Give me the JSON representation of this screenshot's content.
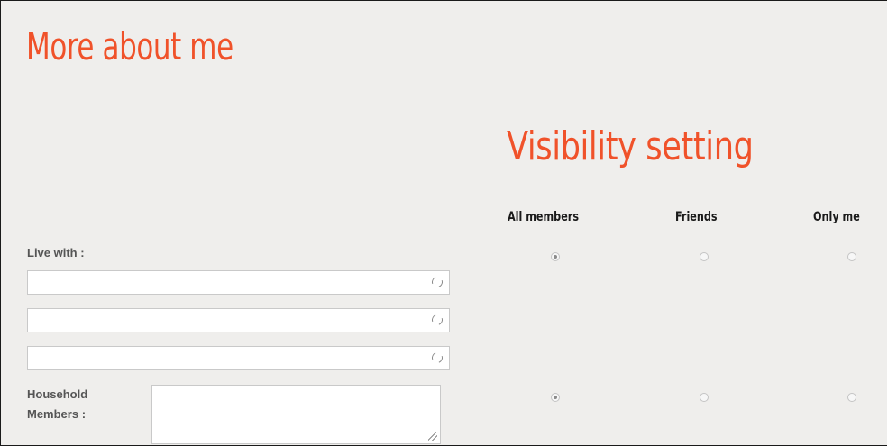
{
  "form": {
    "title": "More about me",
    "live_with_label": "Live with :",
    "household_label_line1": "Household",
    "household_label_line2": "Members :",
    "live_with_inputs": [
      {
        "value": "",
        "icon": "refresh-icon"
      },
      {
        "value": "",
        "icon": "refresh-icon"
      },
      {
        "value": "",
        "icon": "refresh-icon"
      }
    ],
    "household_members_value": ""
  },
  "visibility": {
    "title": "Visibility setting",
    "columns": [
      "All members",
      "Friends",
      "Only me"
    ],
    "rows": [
      {
        "field": "live_with",
        "selected": "All members"
      },
      {
        "field": "household_members",
        "selected": "All members"
      }
    ]
  },
  "colors": {
    "accent": "#f0522a",
    "background": "#efeeec"
  }
}
